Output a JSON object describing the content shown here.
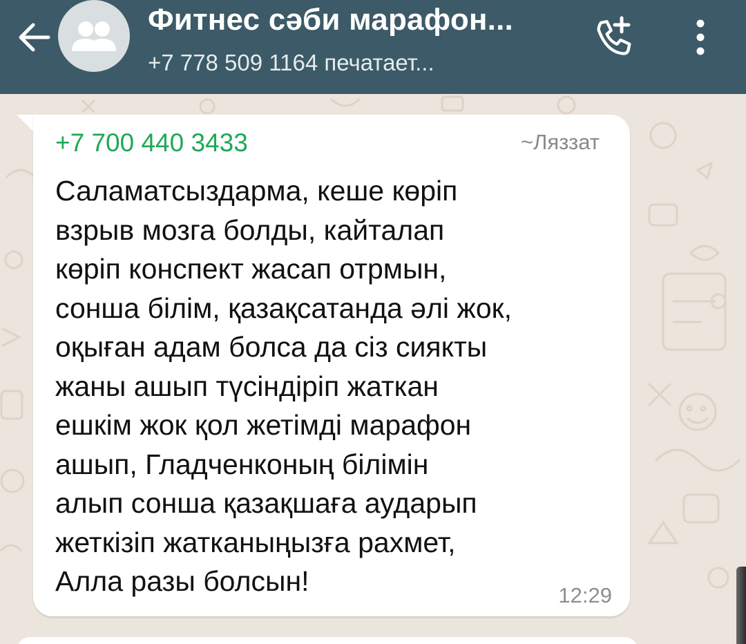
{
  "header": {
    "title": "Фитнес сәби марафон...",
    "subtitle": "+7 778 509 1164 печатает...",
    "back_icon": "arrow-left-icon",
    "avatar_icon": "group-avatar-icon",
    "call_icon": "add-call-icon",
    "menu_icon": "more-vertical-icon",
    "colors": {
      "bar": "#3c5a67",
      "title": "#ffffff"
    }
  },
  "message": {
    "sender_phone": "+7 700 440 3433",
    "sender_name": "~Ляззат",
    "text": "Саламатсыздарма, кеше көріп\nвзрыв мозга болды, кайталап\nкөріп конспект жасап отрмын,\nсонша білім, қазақсатанда әлі жок,\nоқыған адам болса да сіз сиякты\nжаны ашып түсіндіріп жаткан\nешкім жок қол жетімді марафон\nашып, Гладченконың білімін\nалып сонша қазақшаға аударып\nжеткізіп жатканыңызға рахмет,\nАлла разы болсын!",
    "time": "12:29",
    "colors": {
      "sender": "#1fa855",
      "bubble": "#ffffff"
    }
  }
}
